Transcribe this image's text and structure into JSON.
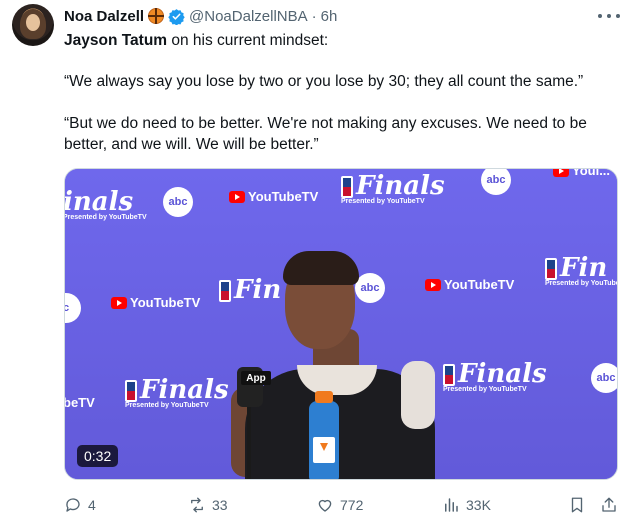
{
  "author": {
    "name": "Noa Dalzell",
    "handle": "@NoaDalzellNBA",
    "separator": "·",
    "time": "6h",
    "badges": [
      "basketball-icon",
      "verified-icon"
    ]
  },
  "tweet": {
    "mention": "Jayson Tatum",
    "intro_rest": " on his current mindset:",
    "quote1": "“We always say you lose by two or you lose by 30; they all count the same.”",
    "quote2": "“But we do need to be better. We're not making any excuses. We need to be better, and we will. We will be better.”"
  },
  "media": {
    "duration": "0:32",
    "backdrop": {
      "finals_word": "Finals",
      "finals_sub": "Presented by YouTubeTV",
      "abc_label": "abc",
      "ytv_label": "YouTubeTV",
      "mic_label": "App",
      "partial_finals": "inals",
      "partial_fin": "Fin",
      "partial_be": "beTV",
      "partial_c": "c",
      "partial_top": "Youi..."
    }
  },
  "actions": {
    "replies": "4",
    "retweets": "33",
    "likes": "772",
    "views": "33K"
  },
  "colors": {
    "text": "#0f1419",
    "secondary": "#536471",
    "verified": "#1d9bf0",
    "backdrop": "#6b64e6"
  }
}
